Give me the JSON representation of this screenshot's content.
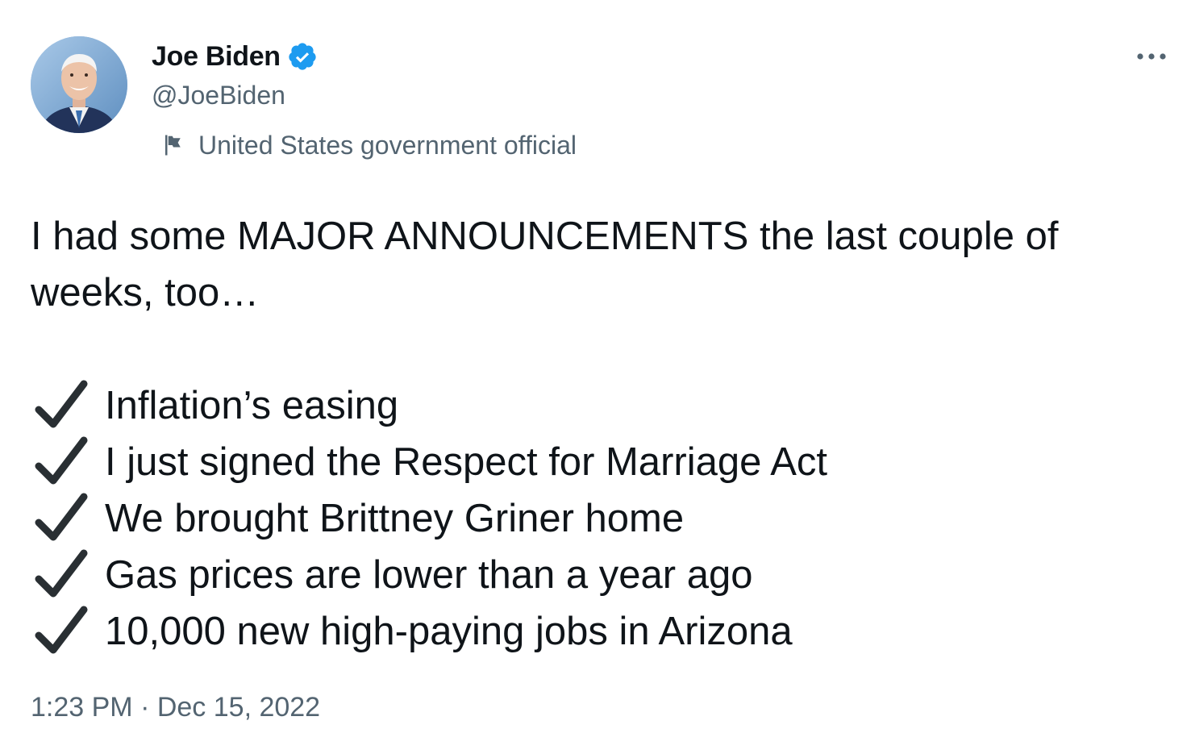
{
  "author": {
    "name": "Joe Biden",
    "handle": "@JoeBiden",
    "verified": true,
    "verified_color": "#1d9bf0",
    "label": "United States government official",
    "label_icon": "flag-icon"
  },
  "menu": {
    "more_icon": "more-horizontal-icon"
  },
  "tweet": {
    "intro": "I had some MAJOR ANNOUNCEMENTS the last couple of weeks, too…",
    "items": [
      "Inflation’s easing",
      "I just signed the Respect for Marriage Act",
      "We brought Brittney Griner home",
      "Gas prices are lower than a year ago",
      "10,000 new high-paying jobs in Arizona"
    ],
    "item_icon": "heavy-check-mark-icon",
    "timestamp": "1:23 PM · Dec 15, 2022"
  },
  "colors": {
    "text_primary": "#0f1419",
    "text_secondary": "#536471",
    "accent": "#1d9bf0"
  }
}
